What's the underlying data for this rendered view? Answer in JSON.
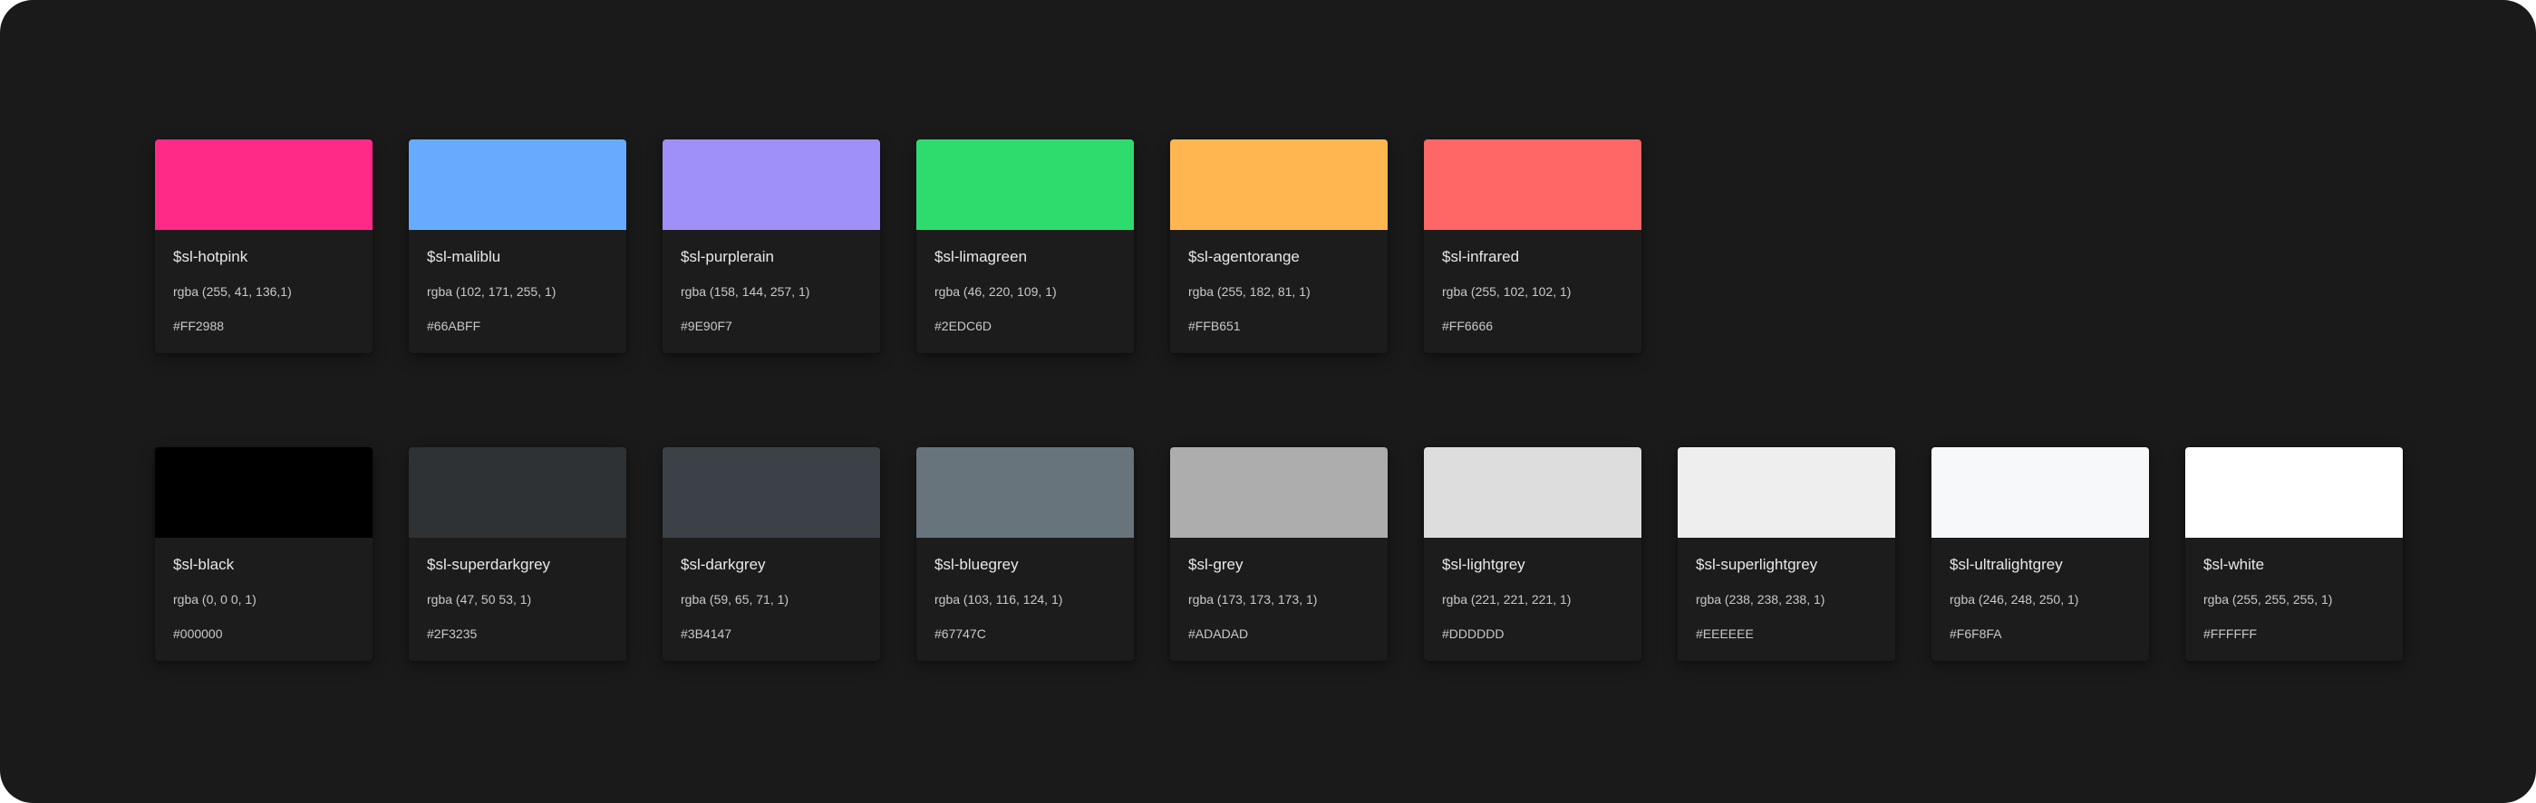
{
  "palette": {
    "brand": [
      {
        "name": "$sl-hotpink",
        "rgba": "rgba (255, 41, 136,1)",
        "hex": "#FF2988",
        "color": "#FF2988"
      },
      {
        "name": "$sl-maliblu",
        "rgba": "rgba (102, 171, 255, 1)",
        "hex": "#66ABFF",
        "color": "#66ABFF"
      },
      {
        "name": "$sl-purplerain",
        "rgba": "rgba (158, 144, 257, 1)",
        "hex": "#9E90F7",
        "color": "#9E90F7"
      },
      {
        "name": "$sl-limagreen",
        "rgba": "rgba (46, 220, 109, 1)",
        "hex": "#2EDC6D",
        "color": "#2EDC6D"
      },
      {
        "name": "$sl-agentorange",
        "rgba": "rgba (255, 182, 81, 1)",
        "hex": "#FFB651",
        "color": "#FFB651"
      },
      {
        "name": "$sl-infrared",
        "rgba": "rgba (255, 102, 102, 1)",
        "hex": "#FF6666",
        "color": "#FF6666"
      }
    ],
    "neutrals": [
      {
        "name": "$sl-black",
        "rgba": "rgba (0, 0 0, 1)",
        "hex": "#000000",
        "color": "#000000"
      },
      {
        "name": "$sl-superdarkgrey",
        "rgba": "rgba (47, 50 53, 1)",
        "hex": "#2F3235",
        "color": "#2F3235"
      },
      {
        "name": "$sl-darkgrey",
        "rgba": "rgba (59, 65, 71, 1)",
        "hex": "#3B4147",
        "color": "#3B4147"
      },
      {
        "name": "$sl-bluegrey",
        "rgba": "rgba (103, 116, 124, 1)",
        "hex": "#67747C",
        "color": "#67747C"
      },
      {
        "name": "$sl-grey",
        "rgba": "rgba (173, 173, 173, 1)",
        "hex": "#ADADAD",
        "color": "#ADADAD"
      },
      {
        "name": "$sl-lightgrey",
        "rgba": "rgba (221, 221, 221, 1)",
        "hex": "#DDDDDD",
        "color": "#DDDDDD"
      },
      {
        "name": "$sl-superlightgrey",
        "rgba": "rgba (238, 238, 238, 1)",
        "hex": "#EEEEEE",
        "color": "#EEEEEE"
      },
      {
        "name": "$sl-ultralightgrey",
        "rgba": "rgba (246, 248, 250, 1)",
        "hex": "#F6F8FA",
        "color": "#F6F8FA"
      },
      {
        "name": "$sl-white",
        "rgba": "rgba (255, 255, 255, 1)",
        "hex": "#FFFFFF",
        "color": "#FFFFFF"
      }
    ]
  }
}
